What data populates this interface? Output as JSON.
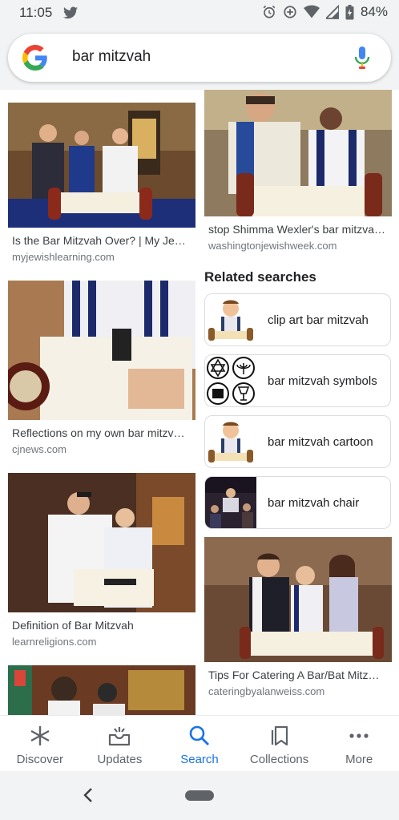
{
  "status": {
    "time": "11:05",
    "battery": "84%"
  },
  "search": {
    "query": "bar mitzvah"
  },
  "results_left": [
    {
      "title": "Is the Bar Mitzvah Over? | My Je…",
      "source": "myjewishlearning.com"
    },
    {
      "title": "Reflections on my own bar mitzv…",
      "source": "cjnews.com"
    },
    {
      "title": "Definition of Bar Mitzvah",
      "source": "learnreligions.com"
    }
  ],
  "results_right": [
    {
      "title": "stop Shimma Wexler's bar mitzva…",
      "source": "washingtonjewishweek.com"
    },
    {
      "title": "Tips For Catering A Bar/Bat Mitz…",
      "source": "cateringbyalanweiss.com"
    }
  ],
  "related": {
    "heading": "Related searches",
    "items": [
      {
        "label": "clip art bar mitzvah"
      },
      {
        "label": "bar mitzvah symbols"
      },
      {
        "label": "bar mitzvah cartoon"
      },
      {
        "label": "bar mitzvah chair"
      }
    ]
  },
  "nav": {
    "items": [
      {
        "label": "Discover",
        "icon": "asterisk-icon"
      },
      {
        "label": "Updates",
        "icon": "inbox-sparkle-icon"
      },
      {
        "label": "Search",
        "icon": "search-icon",
        "active": true
      },
      {
        "label": "Collections",
        "icon": "bookmark-icon"
      },
      {
        "label": "More",
        "icon": "more-dots-icon"
      }
    ],
    "active_color": "#1a73e8"
  }
}
